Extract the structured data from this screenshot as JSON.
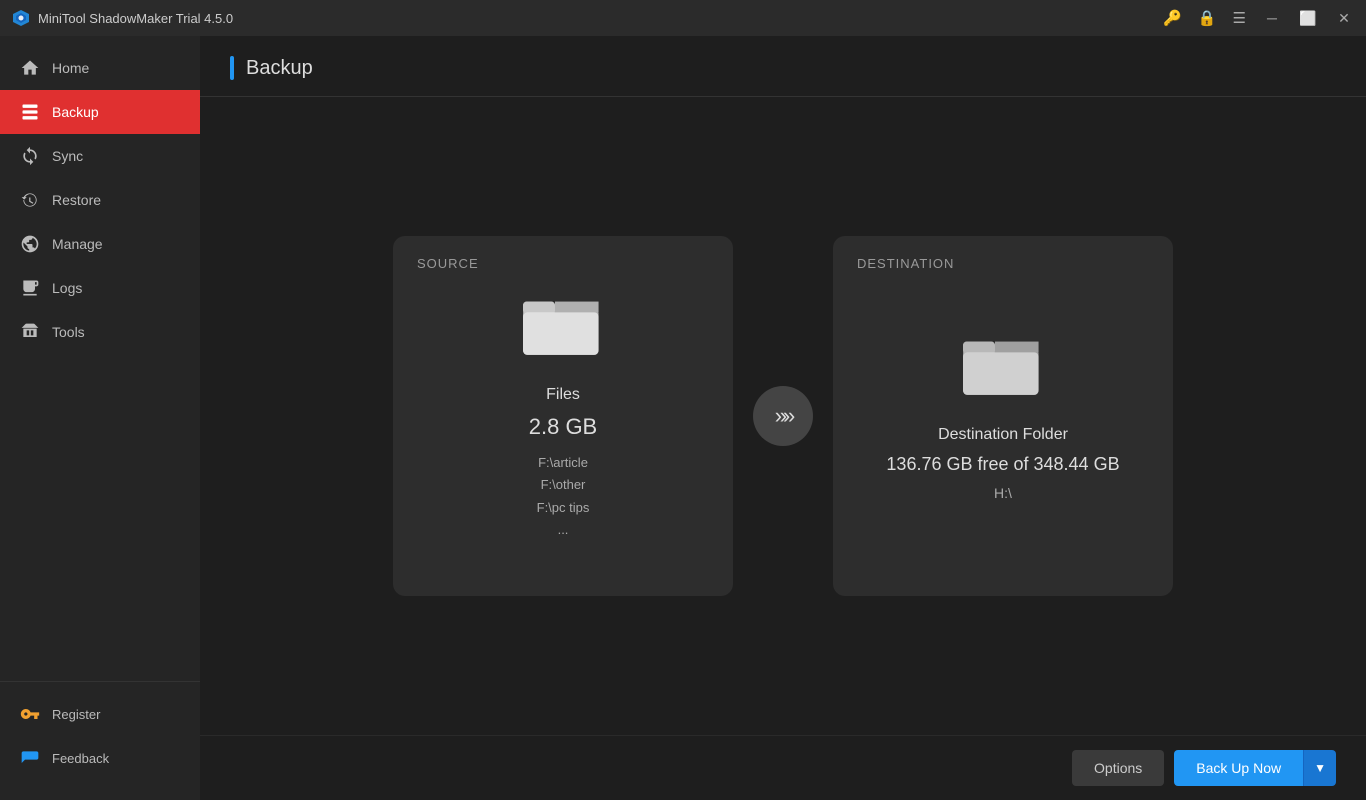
{
  "titleBar": {
    "title": "MiniTool ShadowMaker Trial 4.5.0",
    "controls": [
      "key-icon",
      "lock-icon",
      "menu-icon",
      "minimize-icon",
      "maximize-icon",
      "close-icon"
    ]
  },
  "sidebar": {
    "items": [
      {
        "id": "home",
        "label": "Home",
        "icon": "home-icon"
      },
      {
        "id": "backup",
        "label": "Backup",
        "icon": "backup-icon",
        "active": true
      },
      {
        "id": "sync",
        "label": "Sync",
        "icon": "sync-icon"
      },
      {
        "id": "restore",
        "label": "Restore",
        "icon": "restore-icon"
      },
      {
        "id": "manage",
        "label": "Manage",
        "icon": "manage-icon"
      },
      {
        "id": "logs",
        "label": "Logs",
        "icon": "logs-icon"
      },
      {
        "id": "tools",
        "label": "Tools",
        "icon": "tools-icon"
      }
    ],
    "bottom": [
      {
        "id": "register",
        "label": "Register",
        "icon": "register-icon"
      },
      {
        "id": "feedback",
        "label": "Feedback",
        "icon": "feedback-icon"
      }
    ]
  },
  "page": {
    "title": "Backup"
  },
  "source": {
    "label": "SOURCE",
    "name": "Files",
    "size": "2.8 GB",
    "paths": [
      "F:\\article",
      "F:\\other",
      "F:\\pc tips",
      "..."
    ]
  },
  "destination": {
    "label": "DESTINATION",
    "name": "Destination Folder",
    "free": "136.76 GB free of 348.44 GB",
    "drive": "H:\\"
  },
  "buttons": {
    "options": "Options",
    "backupNow": "Back Up Now"
  }
}
